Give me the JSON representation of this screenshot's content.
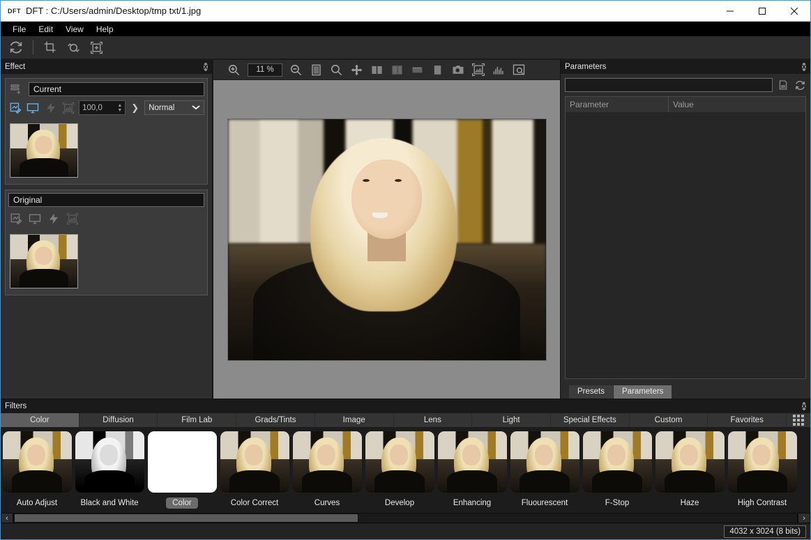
{
  "window": {
    "logo": "DFT",
    "title": "DFT : C:/Users/admin/Desktop/tmp txt/1.jpg",
    "minimize": "minimize",
    "maximize": "maximize",
    "close": "close"
  },
  "menu": {
    "items": [
      "File",
      "Edit",
      "View",
      "Help"
    ]
  },
  "app_toolbar": {
    "icons": [
      "refresh-icon",
      "crop-icon",
      "rotate-icon",
      "fit-image-icon"
    ]
  },
  "effect_panel": {
    "title": "Effect",
    "close": "x",
    "layers": [
      {
        "name": "Current",
        "add_icon": "add-layer-icon",
        "icons": [
          "edit-mask-icon",
          "monitor-icon",
          "lightning-icon",
          "image-frame-icon"
        ],
        "icon_states": [
          "active",
          "active",
          "dim",
          "dim"
        ],
        "opacity": "100,0",
        "blend_mode": "Normal"
      },
      {
        "name": "Original",
        "icons": [
          "edit-mask-icon",
          "monitor-icon",
          "lightning-icon",
          "image-frame-icon"
        ],
        "icon_states": [
          "inactive",
          "inactive",
          "inactive",
          "inactive"
        ]
      }
    ]
  },
  "viewer": {
    "zoom_level": "11 %",
    "toolbar_icons": [
      "zoom-in-icon",
      "zoom-out-icon",
      "split-view-icon",
      "zoom-select-icon",
      "pan-icon",
      "side-by-side-icon",
      "vertical-split-icon",
      "horizontal-split-icon",
      "single-view-icon",
      "snapshot-icon",
      "fit-to-window-icon",
      "histogram-icon",
      "magnifier-icon"
    ]
  },
  "parameters_panel": {
    "title": "Parameters",
    "close": "x",
    "search_value": "",
    "search_icons": [
      "save-preset-icon",
      "reset-icon"
    ],
    "columns": [
      "Parameter",
      "Value"
    ],
    "rows": [],
    "tabs": [
      {
        "label": "Presets",
        "active": false
      },
      {
        "label": "Parameters",
        "active": true
      }
    ]
  },
  "filters_panel": {
    "title": "Filters",
    "close": "x",
    "grid_icon": "grid-view-icon",
    "categories": [
      {
        "label": "Color",
        "active": true
      },
      {
        "label": "Diffusion",
        "active": false
      },
      {
        "label": "Film Lab",
        "active": false
      },
      {
        "label": "Grads/Tints",
        "active": false
      },
      {
        "label": "Image",
        "active": false
      },
      {
        "label": "Lens",
        "active": false
      },
      {
        "label": "Light",
        "active": false
      },
      {
        "label": "Special Effects",
        "active": false
      },
      {
        "label": "Custom",
        "active": false
      },
      {
        "label": "Favorites",
        "active": false
      }
    ],
    "filters": [
      {
        "label": "Auto Adjust",
        "selected": false,
        "preview": "color"
      },
      {
        "label": "Black and White",
        "selected": false,
        "preview": "bw"
      },
      {
        "label": "Color",
        "selected": true,
        "preview": "blank"
      },
      {
        "label": "Color Correct",
        "selected": false,
        "preview": "color"
      },
      {
        "label": "Curves",
        "selected": false,
        "preview": "color"
      },
      {
        "label": "Develop",
        "selected": false,
        "preview": "color"
      },
      {
        "label": "Enhancing",
        "selected": false,
        "preview": "color"
      },
      {
        "label": "Fluourescent",
        "selected": false,
        "preview": "color"
      },
      {
        "label": "F-Stop",
        "selected": false,
        "preview": "color"
      },
      {
        "label": "Haze",
        "selected": false,
        "preview": "color"
      },
      {
        "label": "High Contrast",
        "selected": false,
        "preview": "color"
      }
    ],
    "scroll_left": "‹",
    "scroll_right": "›"
  },
  "status_bar": {
    "image_info": "4032 x 3024 (8 bits)"
  },
  "colors": {
    "accent_blue": "#2f9fe0",
    "panel_bg": "#2e2e2e",
    "canvas_bg": "#8b8b8b",
    "titlebar_bg": "#ffffff"
  }
}
